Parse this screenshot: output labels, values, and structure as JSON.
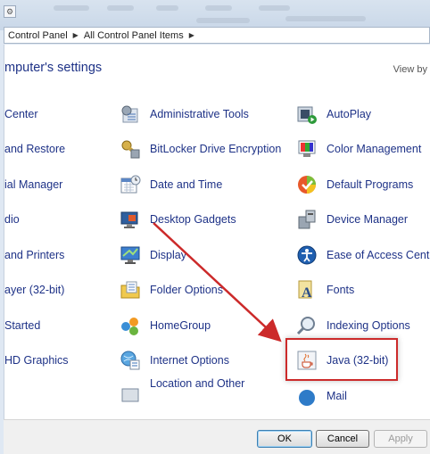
{
  "breadcrumb": [
    "Control Panel",
    "All Control Panel Items"
  ],
  "heading": "mputer's settings",
  "view_by": "View by",
  "columns": {
    "left": [
      "Center",
      "and Restore",
      "ial Manager",
      "dio",
      "and Printers",
      "ayer (32-bit)",
      "Started",
      "HD Graphics"
    ],
    "middle": [
      "Administrative Tools",
      "BitLocker Drive Encryption",
      "Date and Time",
      "Desktop Gadgets",
      "Display",
      "Folder Options",
      "HomeGroup",
      "Internet Options",
      "Location and Other"
    ],
    "right": [
      "AutoPlay",
      "Color Management",
      "Default Programs",
      "Device Manager",
      "Ease of Access Center",
      "Fonts",
      "Indexing Options",
      "Java (32-bit)",
      "Mail"
    ]
  },
  "icons": {
    "middle": [
      "admin-tools-icon",
      "bitlocker-icon",
      "date-time-icon",
      "desktop-gadgets-icon",
      "display-icon",
      "folder-options-icon",
      "homegroup-icon",
      "internet-options-icon",
      "location-icon"
    ],
    "right": [
      "autoplay-icon",
      "color-management-icon",
      "default-programs-icon",
      "device-manager-icon",
      "ease-of-access-icon",
      "fonts-icon",
      "indexing-options-icon",
      "java-icon",
      "mail-icon"
    ]
  },
  "buttons": {
    "ok": "OK",
    "cancel": "Cancel",
    "apply": "Apply"
  },
  "colors": {
    "link": "#1e3287",
    "highlight": "#cc2a2a"
  }
}
